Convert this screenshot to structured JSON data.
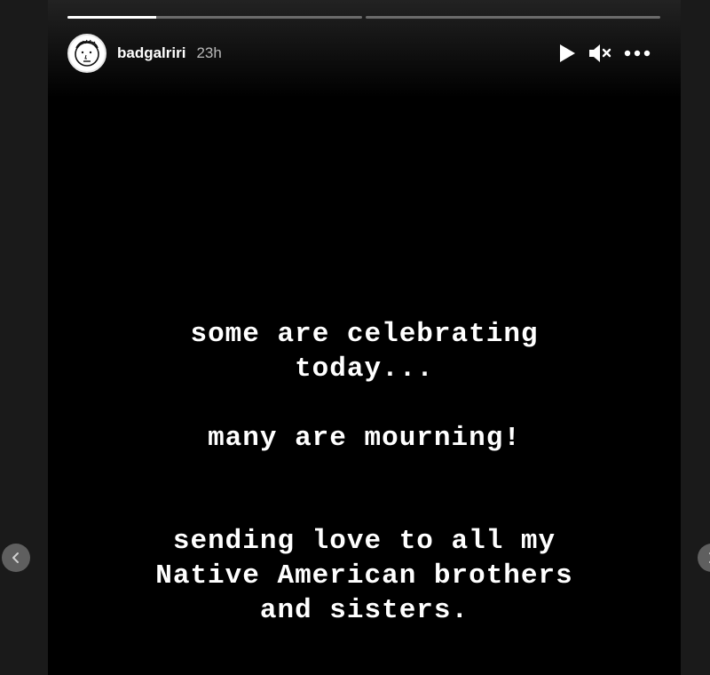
{
  "story": {
    "username": "badgalriri",
    "timestamp": "23h",
    "progress": [
      0.3,
      0
    ],
    "message": {
      "line1": "some are celebrating",
      "line2": "today...",
      "line3": "many are mourning!",
      "line4": "sending love to all my",
      "line5": "Native American brothers",
      "line6": "and sisters."
    }
  },
  "icons": {
    "avatar": "cartoon-face-avatar",
    "play": "play-icon",
    "mute": "speaker-muted-icon",
    "more": "more-options-icon",
    "prev": "chevron-left-icon",
    "next": "chevron-right-icon"
  },
  "colors": {
    "story_background": "#000000",
    "page_background": "#1a1a1a",
    "text": "#ffffff"
  }
}
